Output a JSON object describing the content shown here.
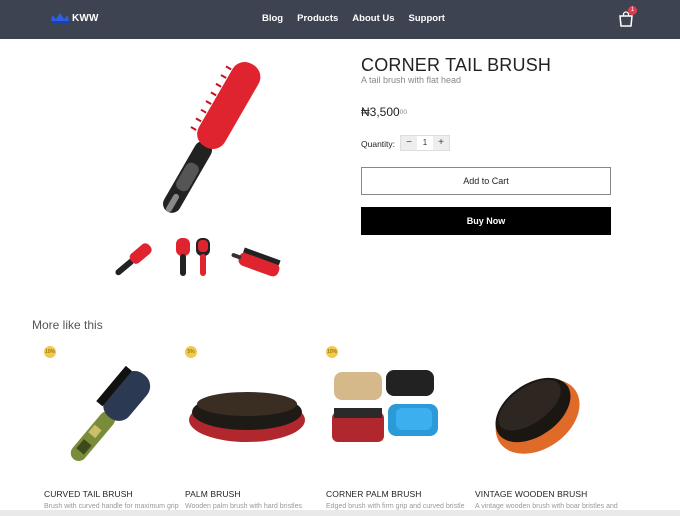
{
  "header": {
    "logo_text": "KWW",
    "nav": [
      "Blog",
      "Products",
      "About Us",
      "Support"
    ],
    "cart_count": "1"
  },
  "product": {
    "title": "CORNER TAIL BRUSH",
    "subtitle": "A tail brush with flat head",
    "price_main": "₦3,500",
    "price_cents": "00",
    "quantity_label": "Quantity:",
    "quantity": "1",
    "minus": "−",
    "plus": "+",
    "add_to_cart": "Add to Cart",
    "buy_now": "Buy Now"
  },
  "related": {
    "title": "More like this",
    "items": [
      {
        "name": "CURVED TAIL BRUSH",
        "desc": "Brush with curved handle for maximum grip",
        "badge": "10%"
      },
      {
        "name": "PALM BRUSH",
        "desc": "Wooden palm brush with hard bristles",
        "badge": "5%"
      },
      {
        "name": "CORNER PALM BRUSH",
        "desc": "Edged brush with firm grip and curved bristle arrangement",
        "badge": "10%"
      },
      {
        "name": "VINTAGE WOODEN BRUSH",
        "desc": "A vintage wooden brush with boar bristles and curved sides for firm grip",
        "badge": ""
      }
    ]
  },
  "colors": {
    "header_bg": "#3d4351",
    "accent_red": "#e23b4a",
    "badge_yellow": "#f2c94c",
    "buy_bg": "#000000"
  }
}
